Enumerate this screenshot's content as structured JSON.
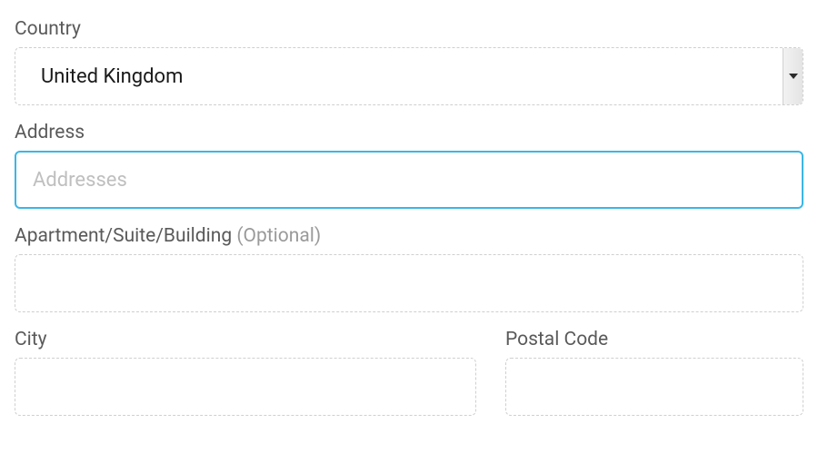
{
  "form": {
    "country": {
      "label": "Country",
      "value": "United Kingdom"
    },
    "address": {
      "label": "Address",
      "placeholder": "Addresses",
      "value": ""
    },
    "apartment": {
      "label": "Apartment/Suite/Building ",
      "optional": "(Optional)",
      "value": ""
    },
    "city": {
      "label": "City",
      "value": ""
    },
    "postal": {
      "label": "Postal Code",
      "value": ""
    }
  }
}
